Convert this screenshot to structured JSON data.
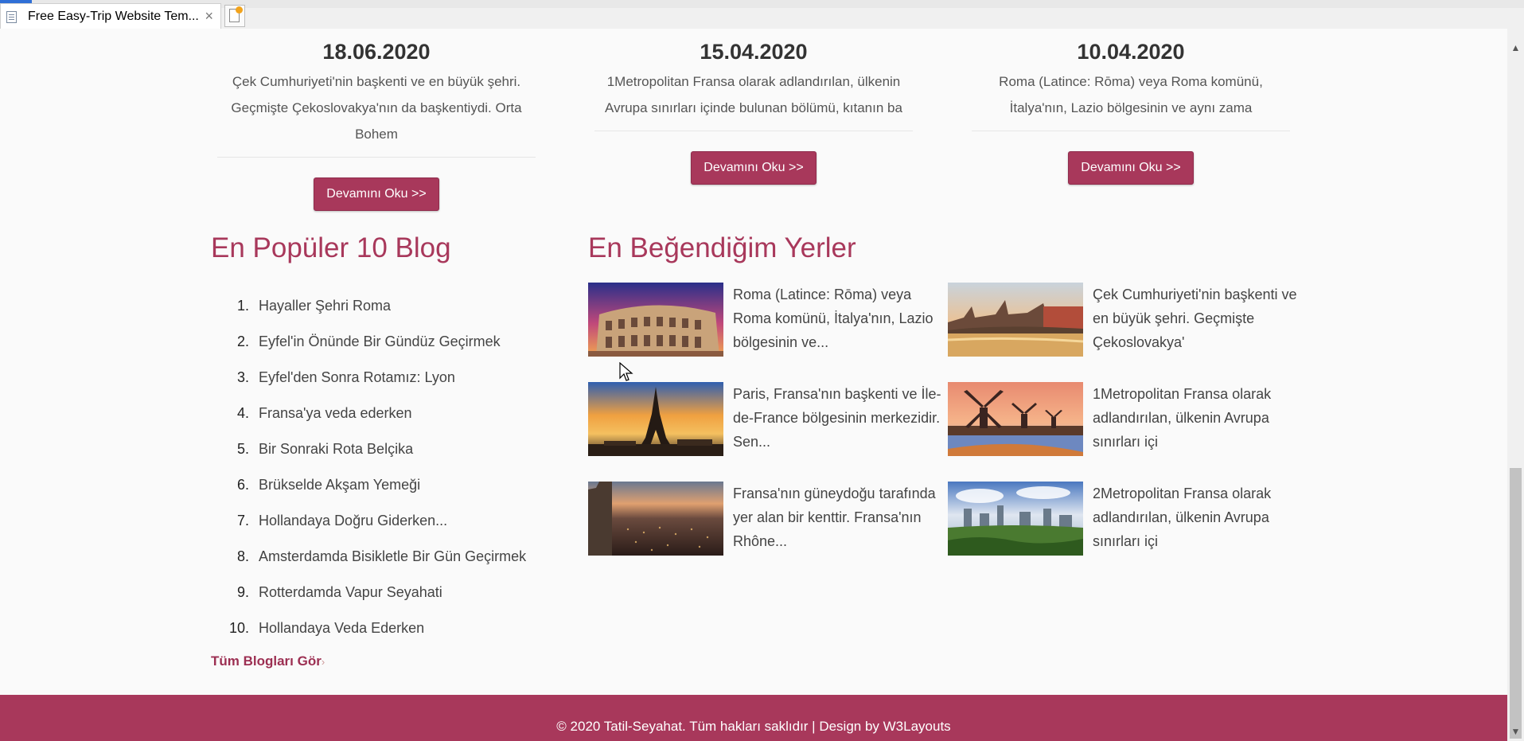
{
  "browser": {
    "tab_title": "Free Easy-Trip Website Tem...",
    "tab_close": "×"
  },
  "recent_posts": [
    {
      "date": "18.06.2020",
      "excerpt": "Çek Cumhuriyeti'nin başkenti ve en büyük şehri. Geçmişte Çekoslovakya'nın da başkentiydi. Orta Bohem",
      "button": "Devamını Oku >>"
    },
    {
      "date": "15.04.2020",
      "excerpt": "1Metropolitan Fransa olarak adlandırılan, ülkenin Avrupa sınırları içinde bulunan bölümü, kıtanın ba",
      "button": "Devamını Oku >>"
    },
    {
      "date": "10.04.2020",
      "excerpt": "Roma (Latince: Rōma) veya Roma komünü, İtalya'nın, Lazio bölgesinin ve aynı zama",
      "button": "Devamını Oku >>"
    }
  ],
  "popular": {
    "title": "En Popüler 10 Blog",
    "items": [
      {
        "num": "1.",
        "label": "Hayaller Şehri Roma"
      },
      {
        "num": "2.",
        "label": "Eyfel'in Önünde Bir Gündüz Geçirmek"
      },
      {
        "num": "3.",
        "label": "Eyfel'den Sonra Rotamız: Lyon"
      },
      {
        "num": "4.",
        "label": "Fransa'ya veda ederken"
      },
      {
        "num": "5.",
        "label": "Bir Sonraki Rota Belçika"
      },
      {
        "num": "6.",
        "label": "Brükselde Akşam Yemeği"
      },
      {
        "num": "7.",
        "label": "Hollandaya Doğru Giderken..."
      },
      {
        "num": "8.",
        "label": "Amsterdamda Bisikletle Bir Gün Geçirmek"
      },
      {
        "num": "9.",
        "label": "Rotterdamda Vapur Seyahati"
      },
      {
        "num": "10.",
        "label": "Hollandaya Veda Ederken"
      }
    ],
    "see_all": "Tüm Blogları Gör",
    "see_all_arrow": "›"
  },
  "favorites": {
    "title": "En Beğendiğim Yerler",
    "items": [
      {
        "text": "Roma (Latince: Rōma) veya Roma komünü, İtalya'nın, Lazio bölgesinin ve...",
        "image": "colosseum-photo"
      },
      {
        "text": "Çek Cumhuriyeti'nin başkenti ve en büyük şehri. Geçmişte Çekoslovakya'",
        "image": "prague-photo"
      },
      {
        "text": "Paris, Fransa'nın başkenti ve İle-de-France bölgesinin merkezidir. Sen...",
        "image": "eiffel-photo"
      },
      {
        "text": "1Metropolitan Fransa olarak adlandırılan, ülkenin Avrupa sınırları içi",
        "image": "windmills-photo"
      },
      {
        "text": "Fransa'nın güneydoğu tarafında yer alan bir kenttir. Fransa'nın Rhône...",
        "image": "lyon-photo"
      },
      {
        "text": "2Metropolitan Fransa olarak adlandırılan, ülkenin Avrupa sınırları içi",
        "image": "rotterdam-photo"
      }
    ]
  },
  "footer": {
    "text": "© 2020 Tatil-Seyahat. Tüm hakları saklıdır | Design by W3Layouts"
  },
  "colors": {
    "accent": "#a8385b",
    "footer_bg": "#a8385b",
    "text": "#444444"
  }
}
